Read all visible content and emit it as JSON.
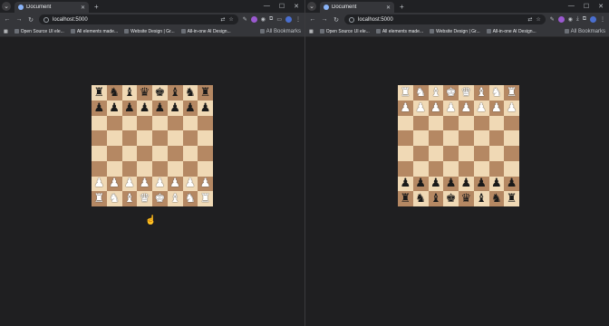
{
  "windows": [
    {
      "tab_title": "Document",
      "url": "localhost:5000",
      "bookmarks": [
        "Open Source UI ele...",
        "All elements made...",
        "Website Design | Gr...",
        "All-in-one AI Design..."
      ],
      "bookmarks_more": "All Bookmarks"
    },
    {
      "tab_title": "Document",
      "url": "localhost:5000",
      "bookmarks": [
        "Open Source UI ele...",
        "All elements made...",
        "Website Design | Gr...",
        "All-in-one AI Design..."
      ],
      "bookmarks_more": "All Bookmarks"
    }
  ],
  "boards": [
    {
      "orientation": "white-bottom",
      "rows": [
        [
          "bR",
          "bN",
          "bB",
          "bQ",
          "bK",
          "bB",
          "bN",
          "bR"
        ],
        [
          "bP",
          "bP",
          "bP",
          "bP",
          "bP",
          "bP",
          "bP",
          "bP"
        ],
        [
          "",
          "",
          "",
          "",
          "",
          "",
          "",
          ""
        ],
        [
          "",
          "",
          "",
          "",
          "",
          "",
          "",
          ""
        ],
        [
          "",
          "",
          "",
          "",
          "",
          "",
          "",
          ""
        ],
        [
          "",
          "",
          "",
          "",
          "",
          "",
          "",
          ""
        ],
        [
          "wP",
          "wP",
          "wP",
          "wP",
          "wP",
          "wP",
          "wP",
          "wP"
        ],
        [
          "wR",
          "wN",
          "wB",
          "wQ",
          "wK",
          "wB",
          "wN",
          "wR"
        ]
      ]
    },
    {
      "orientation": "black-bottom",
      "rows": [
        [
          "wR",
          "wN",
          "wB",
          "wK",
          "wQ",
          "wB",
          "wN",
          "wR"
        ],
        [
          "wP",
          "wP",
          "wP",
          "wP",
          "wP",
          "wP",
          "wP",
          "wP"
        ],
        [
          "",
          "",
          "",
          "",
          "",
          "",
          "",
          ""
        ],
        [
          "",
          "",
          "",
          "",
          "",
          "",
          "",
          ""
        ],
        [
          "",
          "",
          "",
          "",
          "",
          "",
          "",
          ""
        ],
        [
          "",
          "",
          "",
          "",
          "",
          "",
          "",
          ""
        ],
        [
          "bP",
          "bP",
          "bP",
          "bP",
          "bP",
          "bP",
          "bP",
          "bP"
        ],
        [
          "bR",
          "bN",
          "bB",
          "bK",
          "bQ",
          "bB",
          "bN",
          "bR"
        ]
      ]
    }
  ],
  "glyphs": {
    "K": "♚",
    "Q": "♛",
    "R": "♜",
    "B": "♝",
    "N": "♞",
    "P": "♟"
  },
  "colors": {
    "light_square": "#f0d9b5",
    "dark_square": "#b58863"
  }
}
